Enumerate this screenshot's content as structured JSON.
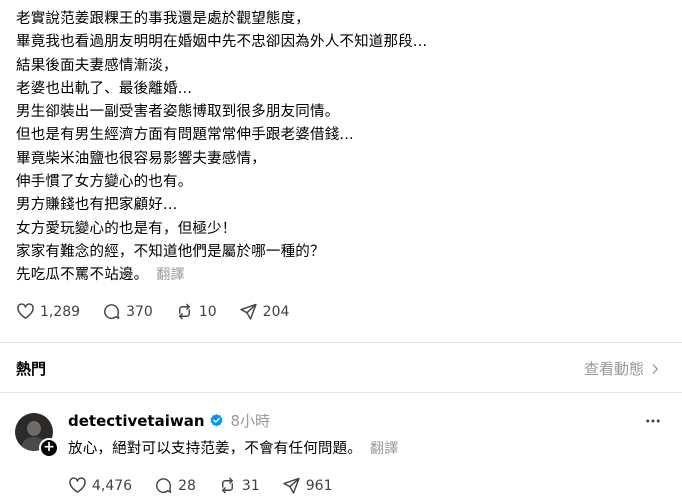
{
  "post": {
    "lines": [
      "老實說范姜跟粿王的事我還是處於觀望態度，",
      "畢竟我也看過朋友明明在婚姻中先不忠卻因為外人不知道那段...",
      "結果後面夫妻感情漸淡，",
      "老婆也出軌了、最後離婚...",
      "男生卻裝出一副受害者姿態博取到很多朋友同情。",
      "但也是有男生經濟方面有問題常常伸手跟老婆借錢...",
      "畢竟柴米油鹽也很容易影響夫妻感情，",
      "伸手慣了女方變心的也有。",
      "男方賺錢也有把家顧好...",
      "女方愛玩變心的也是有，但極少！",
      "家家有難念的經，不知道他們是屬於哪一種的？",
      "先吃瓜不罵不站邊。"
    ],
    "translate": "翻譯",
    "likes": "1,289",
    "replies": "370",
    "reposts": "10",
    "shares": "204"
  },
  "section": {
    "tab": "熱門",
    "view_activity": "查看動態"
  },
  "reply": {
    "username": "detectivetaiwan",
    "time": "8小時",
    "text": "放心，絕對可以支持范姜，不會有任何問題。",
    "translate": "翻譯",
    "likes": "4,476",
    "replies": "28",
    "reposts": "31",
    "shares": "961"
  },
  "colors": {
    "verified": "#0095f6",
    "muted": "#999999"
  }
}
